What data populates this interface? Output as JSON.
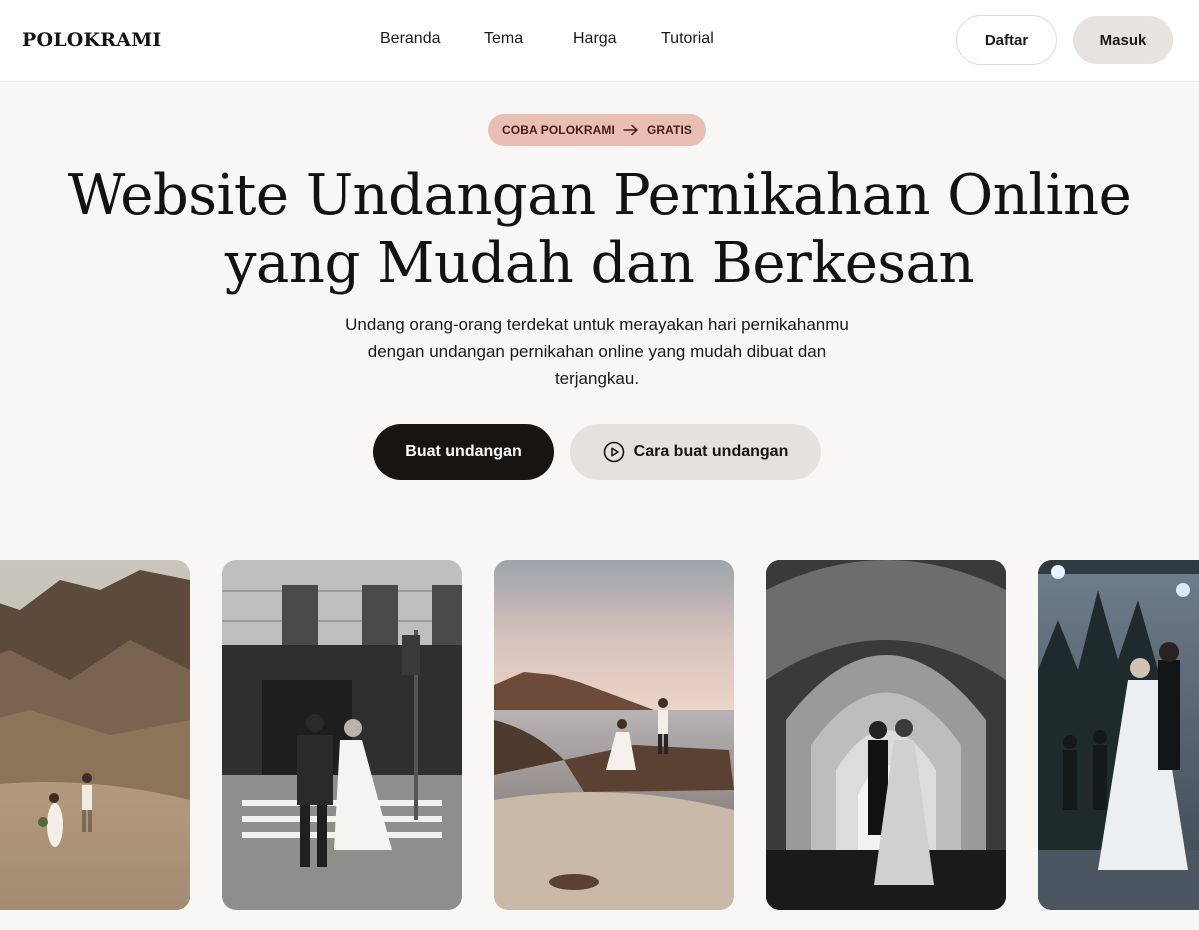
{
  "header": {
    "brand": "POLOKRAMI",
    "nav": [
      "Beranda",
      "Tema",
      "Harga",
      "Tutorial"
    ],
    "daftar_label": "Daftar",
    "masuk_label": "Masuk"
  },
  "promo": {
    "left": "COBA POLOKRAMI",
    "right": "GRATIS",
    "icon": "arrow-right-icon"
  },
  "hero": {
    "title_line1": "Website Undangan Pernikahan Online",
    "title_line2": "yang Mudah dan Berkesan",
    "subtitle_line1": "Undang orang-orang terdekat untuk merayakan hari pernikahanmu",
    "subtitle_line2": "dengan undangan pernikahan online yang mudah dibuat dan",
    "subtitle_line3": "terjangkau.",
    "primary_cta": "Buat undangan",
    "secondary_cta": "Cara buat undangan",
    "secondary_icon": "play-circle-icon"
  },
  "gallery": {
    "photos": [
      "couple-desert-photo",
      "couple-crosswalk-photo",
      "couple-beach-sunset-photo",
      "couple-archway-photo",
      "couple-dance-night-photo"
    ]
  },
  "colors": {
    "page_bg": "#f9f7f5",
    "pill_bg": "#eabfb3",
    "pill_text": "#4a1b12",
    "primary_btn": "#171412",
    "secondary_btn": "#e5e1de"
  }
}
